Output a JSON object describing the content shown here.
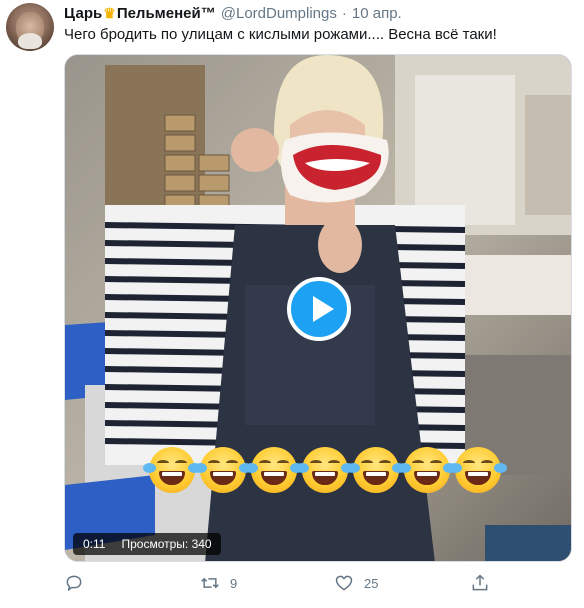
{
  "tweet": {
    "display_name_part1": "Царь",
    "crown_icon": "crown-emoji",
    "display_name_part2": "Пельменей™",
    "handle": "@LordDumplings",
    "separator": "·",
    "date": "10 апр.",
    "text": "Чего бродить по улицам с кислыми рожами.... Весна всё таки!"
  },
  "media": {
    "duration": "0:11",
    "views_label": "Просмотры: 340",
    "emoji_name": "face-with-tears-of-joy",
    "emoji_count": 7,
    "play_color": "#1da1f2"
  },
  "actions": {
    "reply_icon": "reply-icon",
    "reply_count": "",
    "retweet_icon": "retweet-icon",
    "retweet_count": "9",
    "like_icon": "heart-icon",
    "like_count": "25",
    "share_icon": "share-icon"
  },
  "colors": {
    "accent": "#1da1f2",
    "secondary_text": "#657786",
    "primary_text": "#14171a"
  }
}
